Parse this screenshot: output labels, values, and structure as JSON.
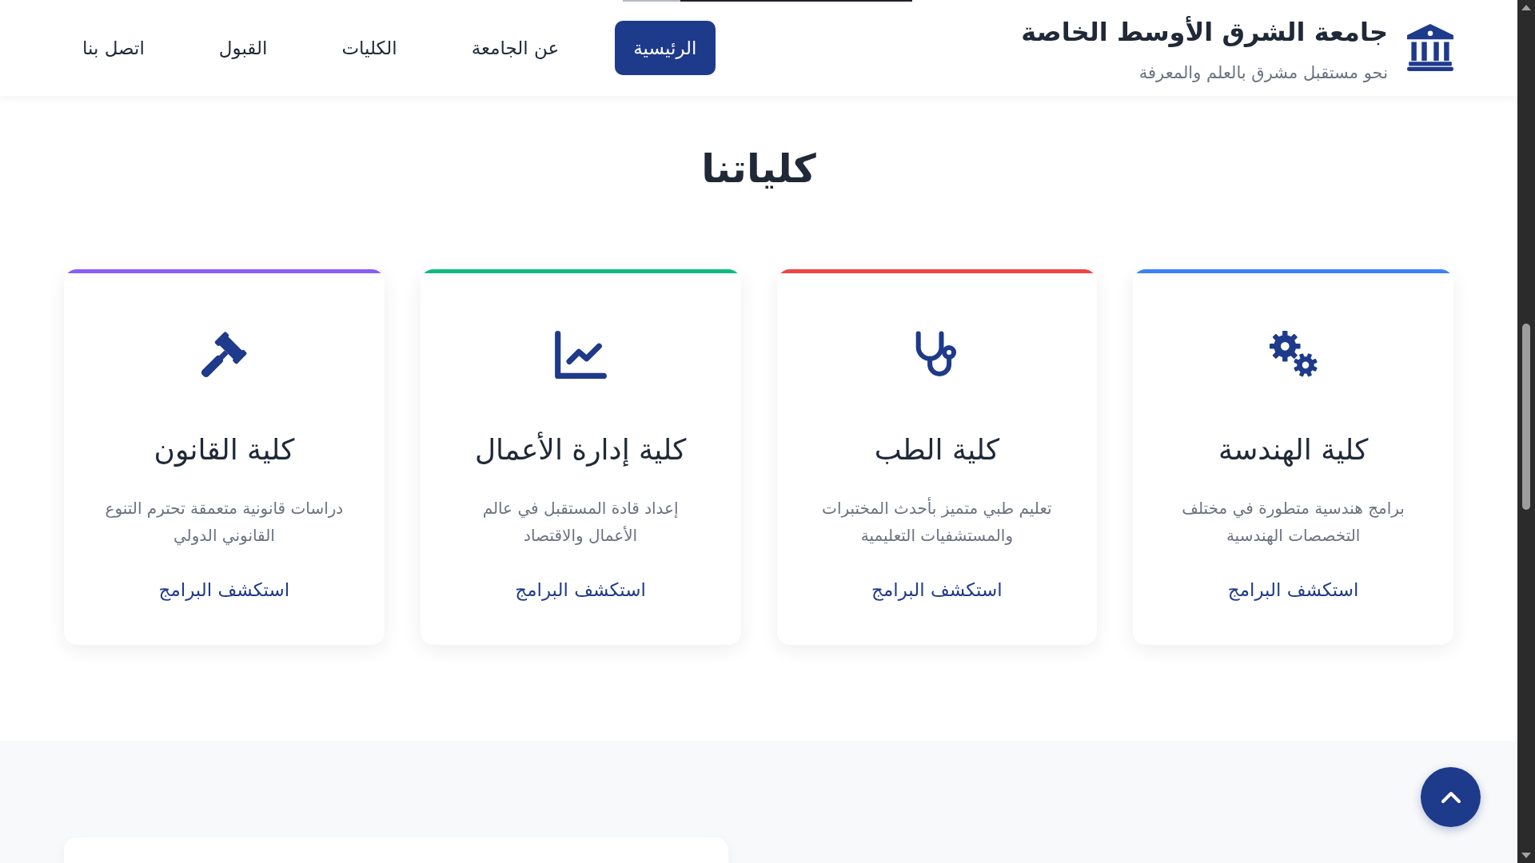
{
  "header": {
    "title": "جامعة الشرق الأوسط الخاصة",
    "tagline": "نحو مستقبل مشرق بالعلم والمعرفة"
  },
  "nav": [
    {
      "label": "الرئيسية",
      "selected": true
    },
    {
      "label": "عن الجامعة",
      "selected": false
    },
    {
      "label": "الكليات",
      "selected": false
    },
    {
      "label": "القبول",
      "selected": false
    },
    {
      "label": "اتصل بنا",
      "selected": false
    }
  ],
  "faculties": {
    "title": "كلياتنا",
    "cards": [
      {
        "kind": "engineering",
        "color": "#3b82f6",
        "title": "كلية الهندسة",
        "description": "برامج هندسية متطورة في مختلف التخصصات الهندسية",
        "link": "استكشف البرامج"
      },
      {
        "kind": "medicine",
        "color": "#ef4444",
        "title": "كلية الطب",
        "description": "تعليم طبي متميز بأحدث المختبرات والمستشفيات التعليمية",
        "link": "استكشف البرامج"
      },
      {
        "kind": "business",
        "color": "#10b981",
        "title": "كلية إدارة الأعمال",
        "description": "إعداد قادة المستقبل في عالم الأعمال والاقتصاد",
        "link": "استكشف البرامج"
      },
      {
        "kind": "law",
        "color": "#8b5cf6",
        "title": "كلية القانون",
        "description": "دراسات قانونية متعمقة تحترم التنوع القانوني الدولي",
        "link": "استكشف البرامج"
      }
    ]
  }
}
